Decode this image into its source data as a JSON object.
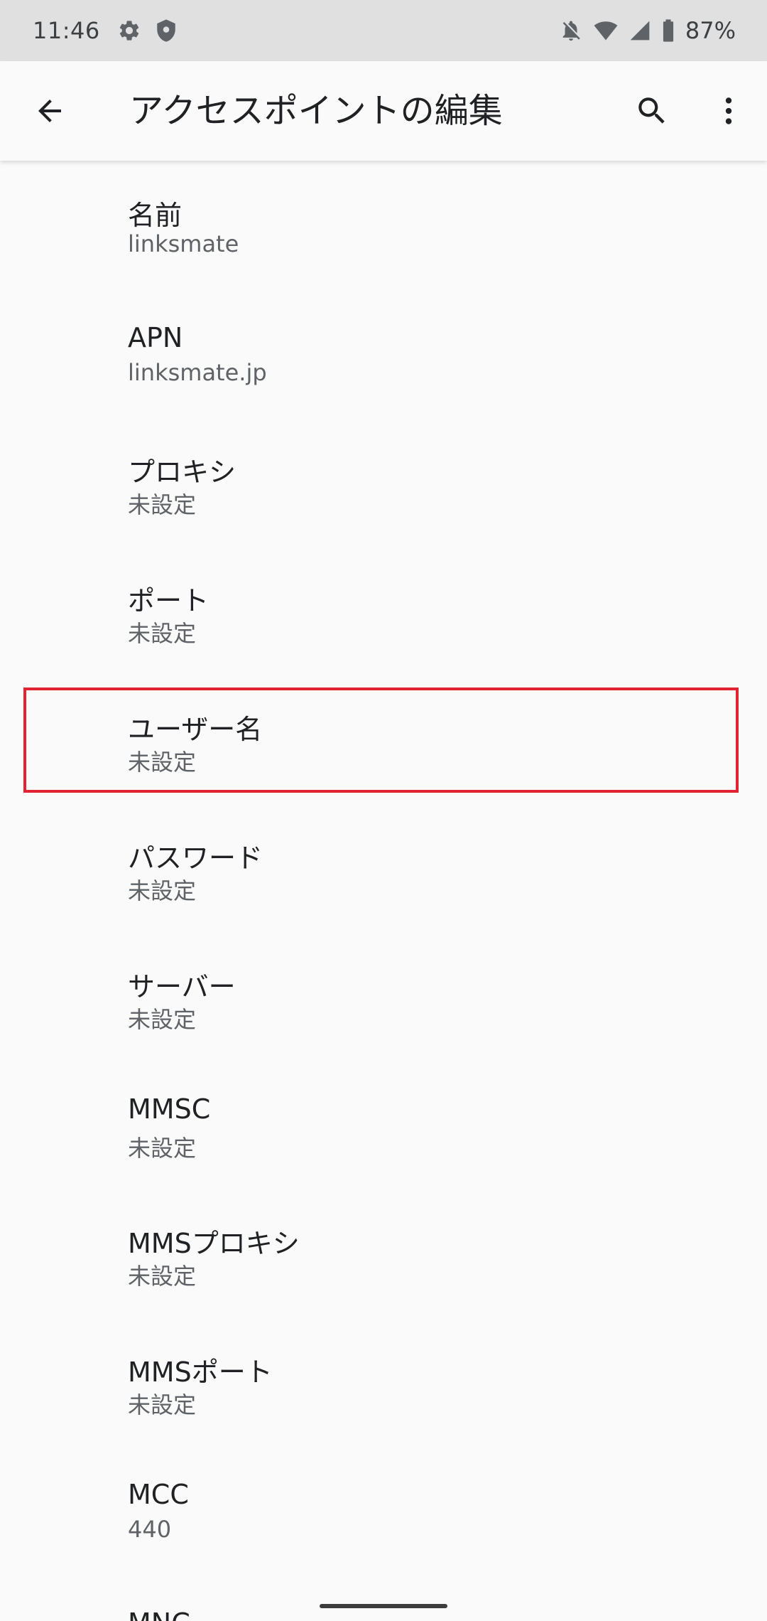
{
  "status_bar": {
    "time": "11:46",
    "battery_percent": "87%",
    "left_icons": [
      "gear-icon",
      "shield-icon"
    ],
    "right_icons": [
      "bell-off-icon",
      "wifi-icon",
      "cell-signal-icon",
      "battery-icon"
    ]
  },
  "toolbar": {
    "title": "アクセスポイントの編集",
    "back_icon": "arrow-back-icon",
    "search_icon": "search-icon",
    "more_icon": "more-vert-icon"
  },
  "list": {
    "items": [
      {
        "title": "名前",
        "summary": " linksmate"
      },
      {
        "title": "APN",
        "summary": "linksmate.jp"
      },
      {
        "title": "プロキシ",
        "summary": "未設定"
      },
      {
        "title": "ポート",
        "summary": "未設定"
      },
      {
        "title": "ユーザー名",
        "summary": "未設定"
      },
      {
        "title": "パスワード",
        "summary": "未設定"
      },
      {
        "title": "サーバー",
        "summary": "未設定"
      },
      {
        "title": "MMSC",
        "summary": "未設定"
      },
      {
        "title": "MMSプロキシ",
        "summary": "未設定"
      },
      {
        "title": "MMSポート",
        "summary": "未設定"
      },
      {
        "title": "MCC",
        "summary": "440"
      },
      {
        "title": "MNC",
        "summary": ""
      }
    ]
  },
  "colors": {
    "status_bar_bg": "#e0e0e0",
    "page_bg": "#fafafa",
    "highlight": "#e02432"
  }
}
